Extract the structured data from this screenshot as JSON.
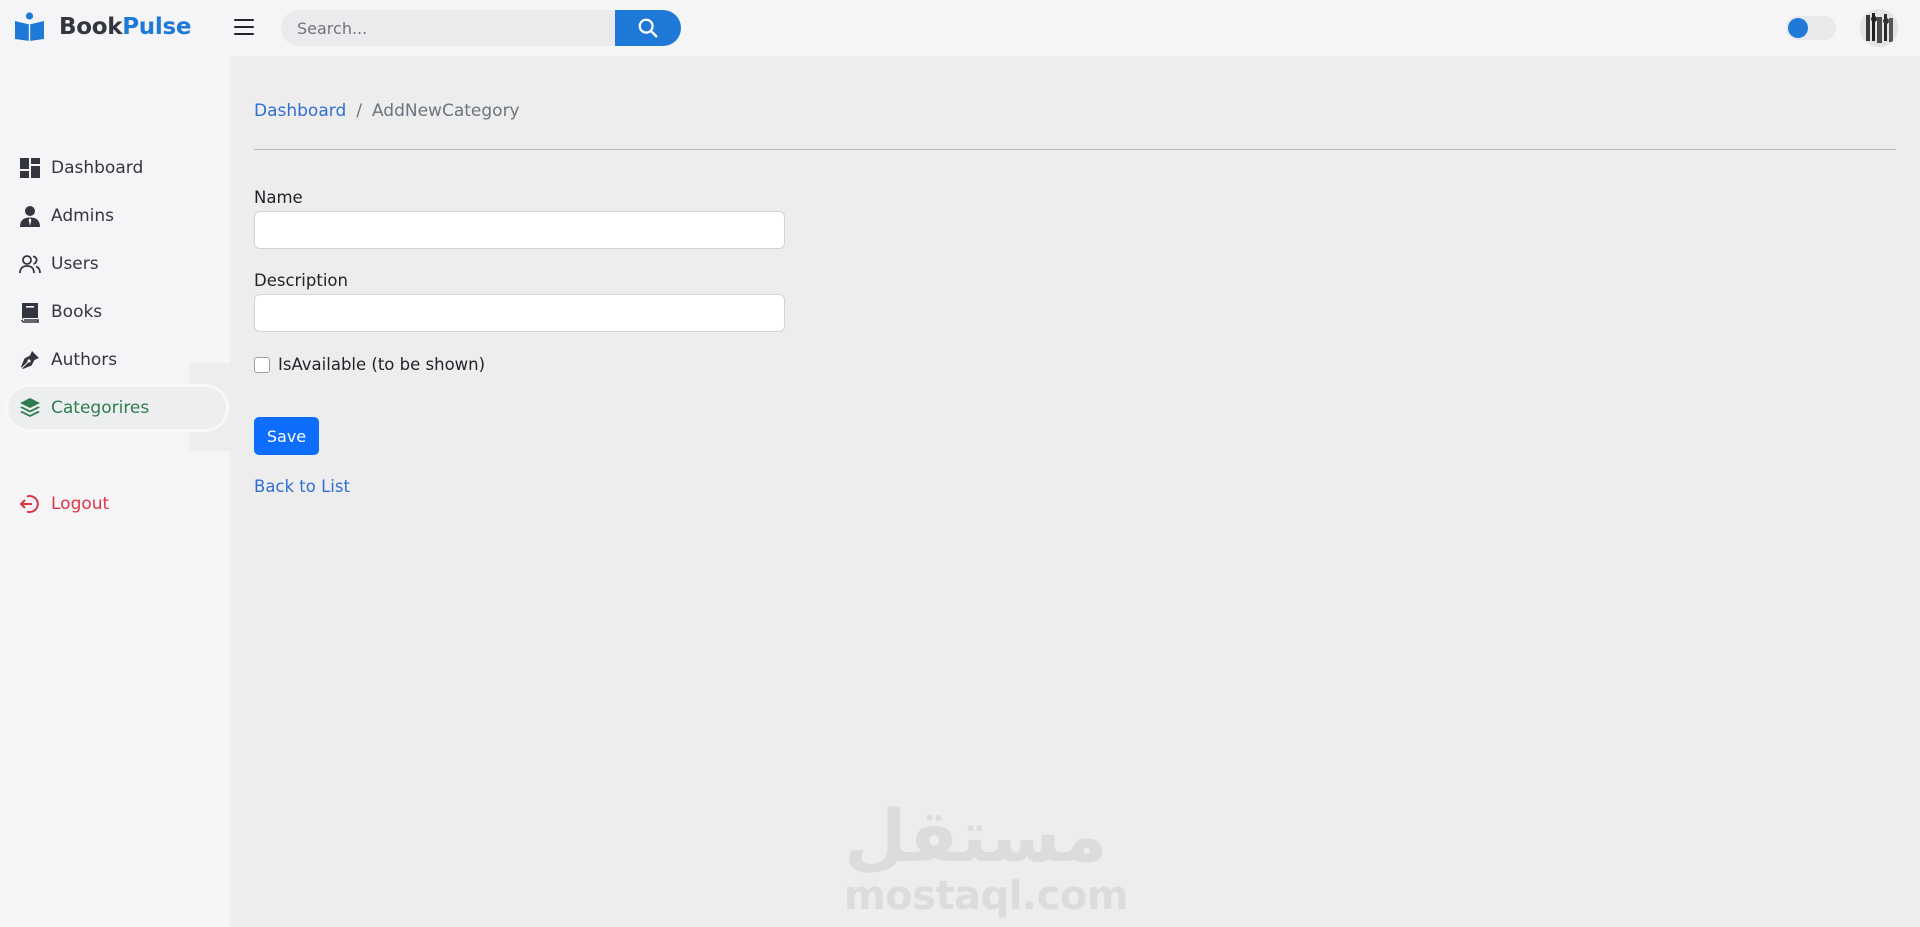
{
  "brand": {
    "name_part1": "Book",
    "name_part2": "Pulse",
    "accent_color": "#1e7ad6"
  },
  "header": {
    "menu_icon": "hamburger-menu-icon",
    "search": {
      "placeholder": "Search...",
      "value": "",
      "button_icon": "search-icon"
    },
    "theme_toggle": {
      "state": "off"
    },
    "avatar_icon": "user-avatar"
  },
  "sidebar": {
    "items": [
      {
        "label": "Dashboard",
        "icon": "dashboard-icon",
        "active": false
      },
      {
        "label": "Admins",
        "icon": "admin-icon",
        "active": false
      },
      {
        "label": "Users",
        "icon": "users-icon",
        "active": false
      },
      {
        "label": "Books",
        "icon": "book-icon",
        "active": false
      },
      {
        "label": "Authors",
        "icon": "pen-nib-icon",
        "active": false
      },
      {
        "label": "Categorires",
        "icon": "layers-icon",
        "active": true
      }
    ],
    "logout": {
      "label": "Logout",
      "icon": "logout-icon",
      "color": "#dc3545"
    }
  },
  "breadcrumb": {
    "home": "Dashboard",
    "separator": "/",
    "current": "AddNewCategory"
  },
  "form": {
    "name_label": "Name",
    "name_value": "",
    "description_label": "Description",
    "description_value": "",
    "available_label": "IsAvailable (to be shown)",
    "available_checked": false,
    "save_label": "Save",
    "back_label": "Back to List"
  },
  "watermark": {
    "arabic": "مستقل",
    "latin": "mostaql.com"
  }
}
